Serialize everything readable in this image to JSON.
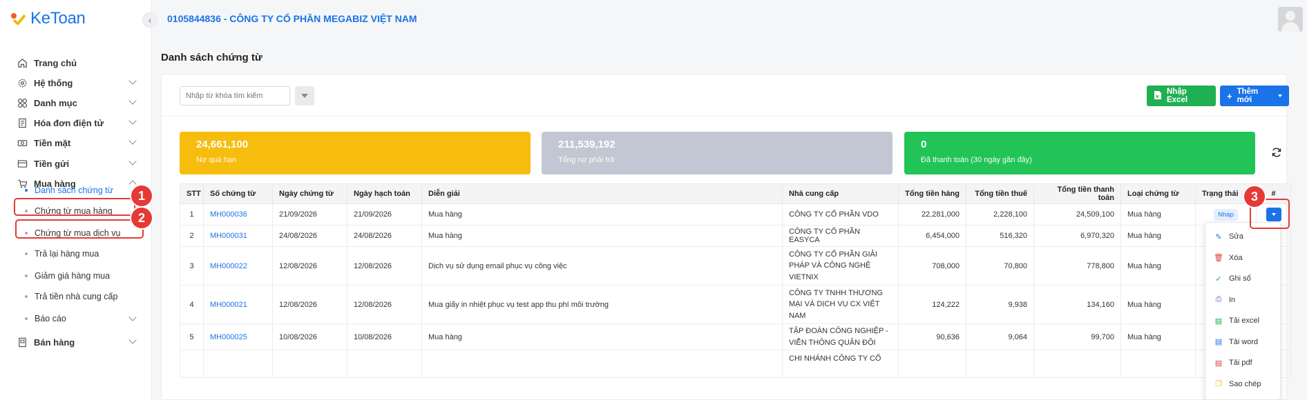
{
  "brand": {
    "logo_text": "KeToan"
  },
  "header": {
    "company": "0105844836 - CÔNG TY CỔ PHẦN MEGABIZ VIỆT NAM"
  },
  "sidebar": {
    "items": [
      {
        "label": "Trang chủ",
        "icon": "home-icon"
      },
      {
        "label": "Hệ thống",
        "icon": "gear-icon"
      },
      {
        "label": "Danh mục",
        "icon": "grid-icon"
      },
      {
        "label": "Hóa đơn điện tử",
        "icon": "invoice-icon"
      },
      {
        "label": "Tiền mặt",
        "icon": "cash-icon"
      },
      {
        "label": "Tiền gửi",
        "icon": "bank-icon"
      },
      {
        "label": "Mua hàng",
        "icon": "cart-icon"
      },
      {
        "label": "Bán hàng",
        "icon": "sales-icon"
      }
    ],
    "sub_items": [
      "Danh sách chứng từ",
      "Chứng từ mua hàng",
      "Chứng từ mua dịch vụ",
      "Trả lại hàng mua",
      "Giảm giá hàng mua",
      "Trả tiền nhà cung cấp",
      "Báo cáo"
    ]
  },
  "annotations": [
    "1",
    "2",
    "3"
  ],
  "page": {
    "title": "Danh sách chứng từ"
  },
  "toolbar": {
    "search_placeholder": "Nhập từ khóa tìm kiếm",
    "import_label": "Nhập Excel",
    "add_label": "Thêm mới"
  },
  "stats": [
    {
      "value": "24,661,100",
      "label": "Nợ quá hạn",
      "color": "#f6bd0f"
    },
    {
      "value": "211,539,192",
      "label": "Tổng nợ phải trả",
      "color": "#c2c7d3"
    },
    {
      "value": "0",
      "label": "Đã thanh toán (30 ngày gần đây)",
      "color": "#22c458"
    }
  ],
  "table": {
    "columns": [
      "STT",
      "Số chứng từ",
      "Ngày chứng từ",
      "Ngày hạch toán",
      "Diễn giải",
      "Nhà cung cấp",
      "Tổng tiền hàng",
      "Tổng tiền thuế",
      "Tổng tiền thanh toán",
      "Loại chứng từ",
      "Trạng thái",
      "#"
    ],
    "rows": [
      {
        "stt": "1",
        "doc": "MH000036",
        "doc_date": "21/09/2026",
        "post_date": "21/09/2026",
        "desc": "Mua hàng",
        "supplier": "CÔNG TY CỔ PHẦN VDO",
        "goods": "22,281,000",
        "tax": "2,228,100",
        "total": "24,509,100",
        "type": "Mua hàng",
        "status": "Nháp"
      },
      {
        "stt": "2",
        "doc": "MH000031",
        "doc_date": "24/08/2026",
        "post_date": "24/08/2026",
        "desc": "Mua hàng",
        "supplier": "CÔNG TY CỔ PHẦN EASYCA",
        "goods": "6,454,000",
        "tax": "516,320",
        "total": "6,970,320",
        "type": "Mua hàng",
        "status": ""
      },
      {
        "stt": "3",
        "doc": "MH000022",
        "doc_date": "12/08/2026",
        "post_date": "12/08/2026",
        "desc": "Dịch vụ sử dụng email phục vụ công việc",
        "supplier": "CÔNG TY CỔ PHẦN GIẢI PHÁP VÀ CÔNG NGHỆ VIETNIX",
        "goods": "708,000",
        "tax": "70,800",
        "total": "778,800",
        "type": "Mua hàng",
        "status": ""
      },
      {
        "stt": "4",
        "doc": "MH000021",
        "doc_date": "12/08/2026",
        "post_date": "12/08/2026",
        "desc": "Mua giấy in nhiệt phục vụ test app thu phí môi trường",
        "supplier": "CÔNG TY TNHH THƯƠNG MẠI VÀ DỊCH VỤ CX VIỆT NAM",
        "goods": "124,222",
        "tax": "9,938",
        "total": "134,160",
        "type": "Mua hàng",
        "status": ""
      },
      {
        "stt": "5",
        "doc": "MH000025",
        "doc_date": "10/08/2026",
        "post_date": "10/08/2026",
        "desc": "Mua hàng",
        "supplier": "TẬP ĐOÀN CÔNG NGHIỆP - VIỄN THÔNG QUÂN ĐỘI",
        "goods": "90,636",
        "tax": "9,064",
        "total": "99,700",
        "type": "Mua hàng",
        "status": ""
      },
      {
        "stt": "",
        "doc": "",
        "doc_date": "",
        "post_date": "",
        "desc": "",
        "supplier": "CHI NHÁNH CÔNG TY CỔ",
        "goods": "",
        "tax": "",
        "total": "",
        "type": "",
        "status": ""
      }
    ]
  },
  "dropdown": [
    {
      "label": "Sửa",
      "icon": "pencil-icon",
      "color": "#1a73e8"
    },
    {
      "label": "Xóa",
      "icon": "trash-icon",
      "color": "#e53935"
    },
    {
      "label": "Ghi sổ",
      "icon": "check-icon",
      "color": "#22a350"
    },
    {
      "label": "In",
      "icon": "printer-icon",
      "color": "#6f42c1"
    },
    {
      "label": "Tải excel",
      "icon": "excel-icon",
      "color": "#22a350"
    },
    {
      "label": "Tải word",
      "icon": "word-icon",
      "color": "#1a73e8"
    },
    {
      "label": "Tải pdf",
      "icon": "pdf-icon",
      "color": "#e53935"
    },
    {
      "label": "Sao chép",
      "icon": "copy-icon",
      "color": "#f5b400"
    }
  ]
}
